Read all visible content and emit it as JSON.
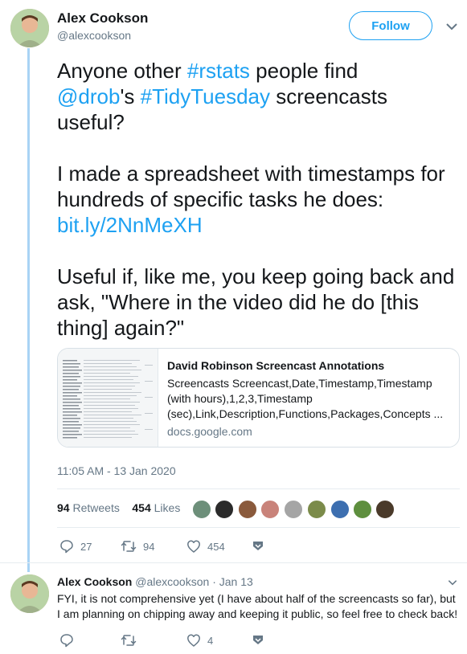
{
  "tweet": {
    "author_name": "Alex Cookson",
    "author_handle": "@alexcookson",
    "follow_label": "Follow",
    "text": {
      "p1_a": "Anyone other ",
      "p1_tag1": "#rstats",
      "p1_b": " people find",
      "p1_mention": "@drob",
      "p1_c": "'s ",
      "p1_tag2": "#TidyTuesday",
      "p1_d": " screencasts useful?",
      "p2": "I made a spreadsheet with timestamps for hundreds of specific tasks he does:",
      "p2_link": "bit.ly/2NnMeXH",
      "p3": "Useful if, like me, you keep going back and ask, \"Where in the video did he do [this thing] again?\""
    },
    "card": {
      "title": "David Robinson Screencast Annotations",
      "description": "Screencasts Screencast,Date,Timestamp,Timestamp (with hours),1,2,3,Timestamp (sec),Link,Description,Functions,Packages,Concepts ...",
      "domain": "docs.google.com"
    },
    "timestamp": "11:05 AM - 13 Jan 2020",
    "retweets_count": "94",
    "retweets_label": "Retweets",
    "likes_count": "454",
    "likes_label": "Likes",
    "actions": {
      "reply_count": "27",
      "retweet_count": "94",
      "like_count": "454"
    }
  },
  "reply": {
    "author_name": "Alex Cookson",
    "author_handle": "@alexcookson",
    "date": "· Jan 13",
    "text": "FYI, it is not comprehensive yet (I have about half of the screencasts so far), but I am planning on chipping away and keeping it public, so feel free to check back!",
    "like_count": "4"
  },
  "colors": {
    "accent": "#1da1f2",
    "thread_line": "#a9d3f5",
    "muted": "#657786"
  },
  "icons": [
    "chevron-down-icon",
    "reply-icon",
    "retweet-icon",
    "heart-icon",
    "bookmark-icon"
  ]
}
